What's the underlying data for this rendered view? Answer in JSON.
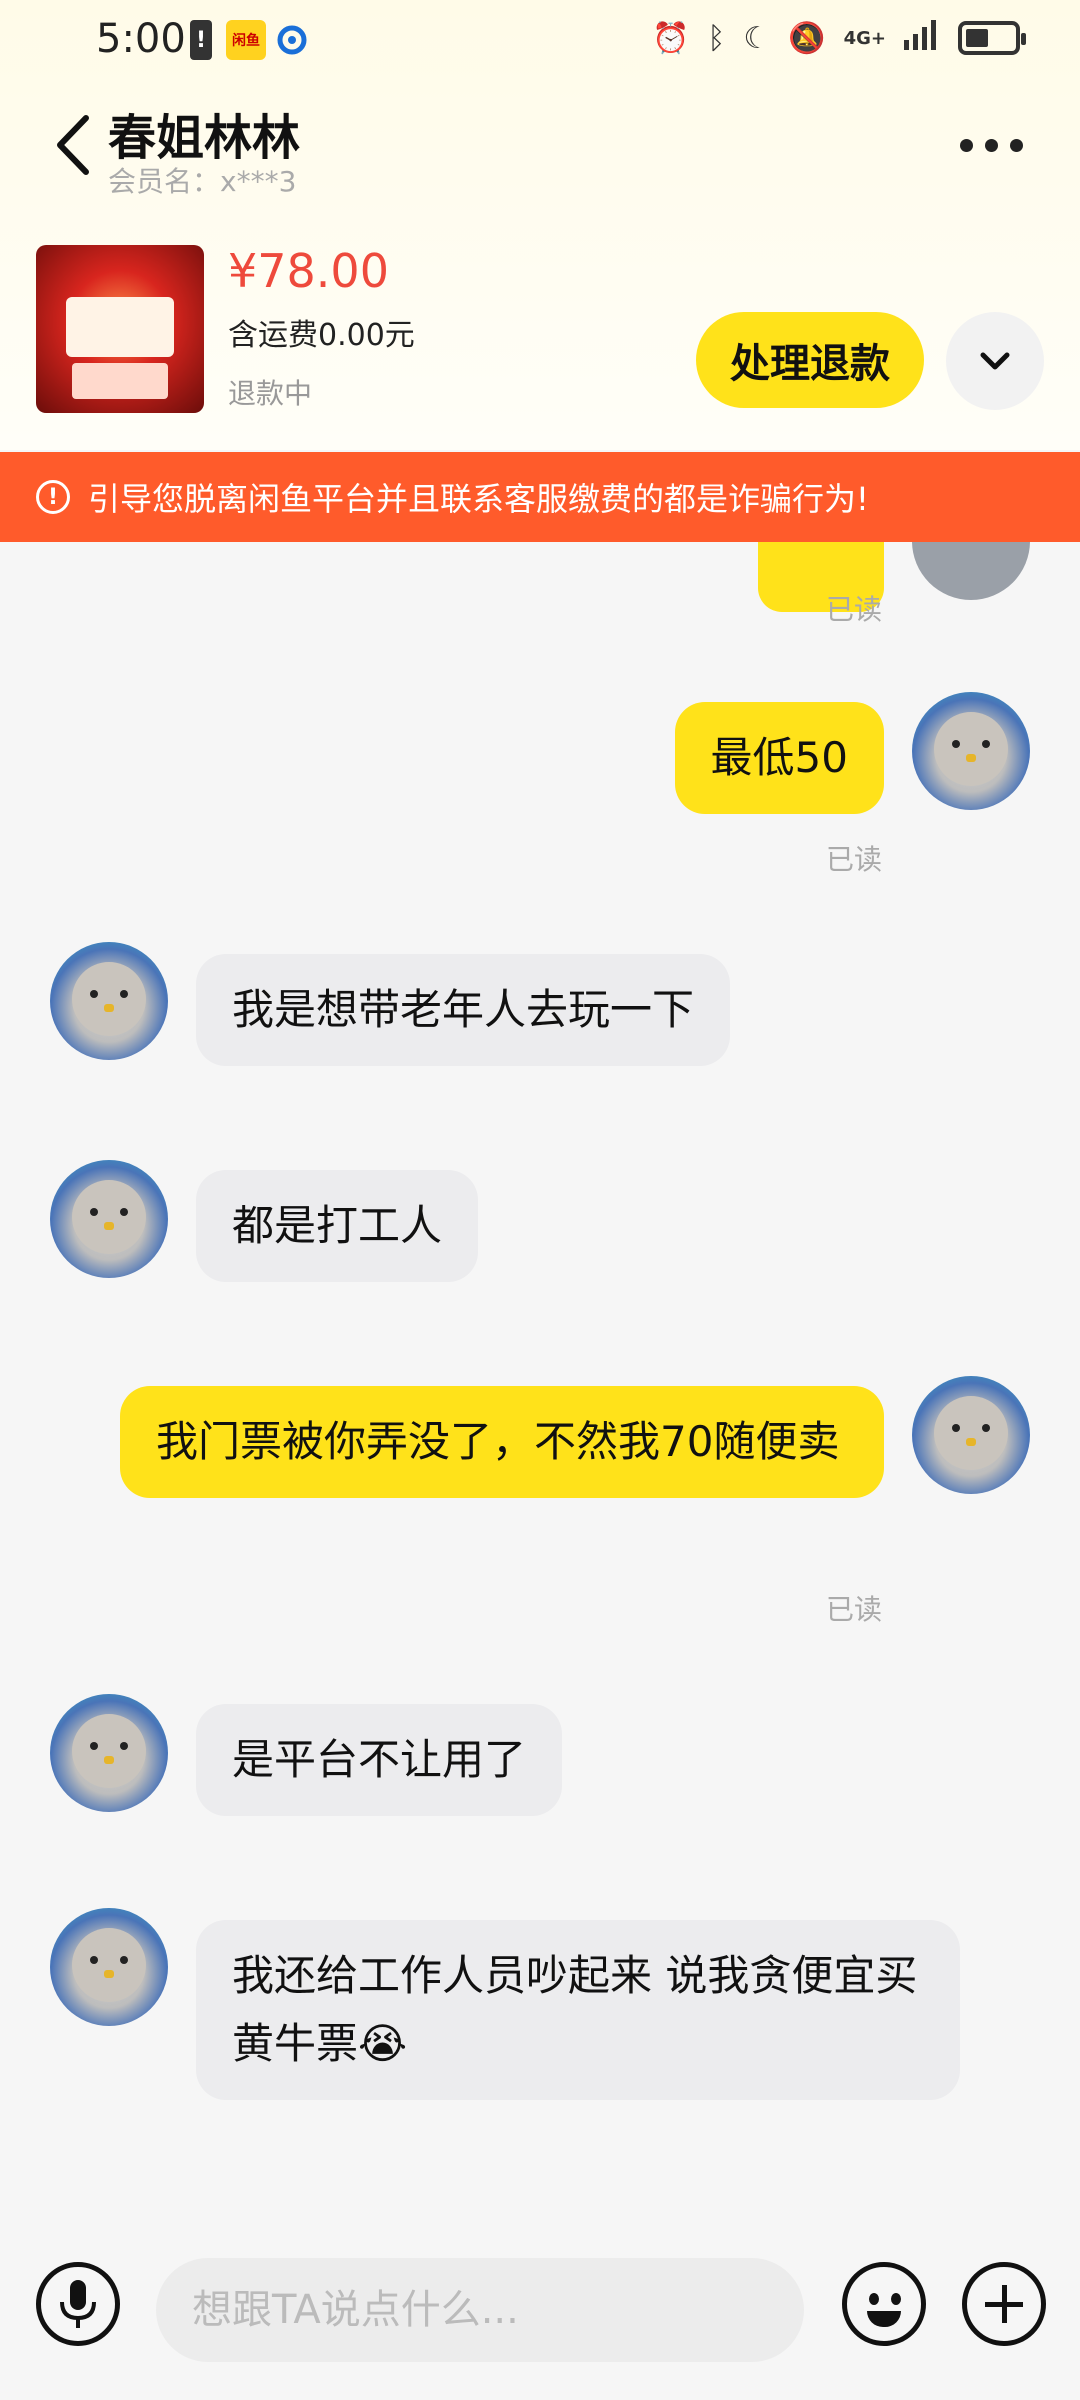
{
  "status_bar": {
    "time": "5:00",
    "app_badge_text": "闲鱼",
    "network": "4G+",
    "icons": [
      "alarm-icon",
      "bluetooth-icon",
      "moon-icon",
      "mute-icon",
      "signal-icon",
      "battery-icon"
    ]
  },
  "header": {
    "title": "春姐林林",
    "member_label": "会员名：x***3"
  },
  "product": {
    "price": "¥78.00",
    "shipping": "含运费0.00元",
    "status": "退款中",
    "action_label": "处理退款"
  },
  "warning": {
    "text": "引导您脱离闲鱼平台并且联系客服缴费的都是诈骗行为!",
    "color": "#ff5b2b"
  },
  "chat": {
    "read_label": "已读",
    "messages": [
      {
        "from": "me",
        "text": "最低50",
        "read": "已读"
      },
      {
        "from": "them",
        "text": "我是想带老年人去玩一下"
      },
      {
        "from": "them",
        "text": "都是打工人"
      },
      {
        "from": "me",
        "text": "我门票被你弄没了，不然我70随便卖",
        "read": "已读"
      },
      {
        "from": "them",
        "text": "是平台不让用了"
      },
      {
        "from": "them",
        "text": "我还给工作人员吵起来 说我贪便宜买黄牛票😭"
      }
    ]
  },
  "input": {
    "placeholder": "想跟TA说点什么..."
  },
  "colors": {
    "accent_yellow": "#ffe21a",
    "price_red": "#ee4a3c",
    "them_bubble": "#ececee"
  }
}
